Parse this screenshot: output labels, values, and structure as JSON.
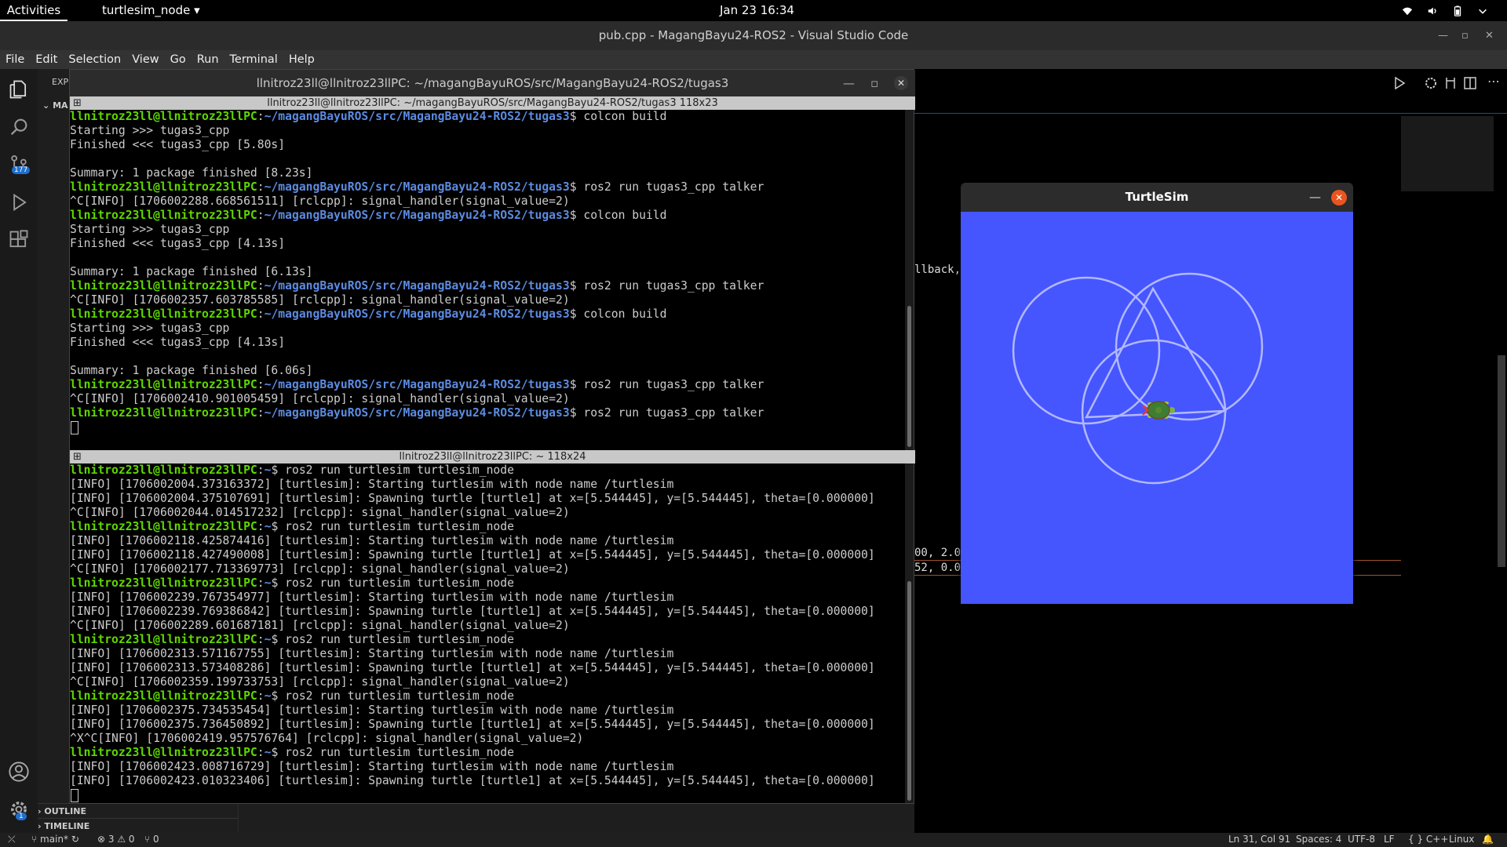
{
  "topbar": {
    "activities": "Activities",
    "app_menu": "turtlesim_node",
    "clock": "Jan 23  16:34"
  },
  "vscode": {
    "title": "pub.cpp - MagangBayu24-ROS2 - Visual Studio Code",
    "menu": [
      "File",
      "Edit",
      "Selection",
      "View",
      "Go",
      "Run",
      "Terminal",
      "Help"
    ],
    "explorer_label": "EXP",
    "explorer_root": "MA",
    "outline": "OUTLINE",
    "timeline": "TIMELINE",
    "scm_badge": "177",
    "settings_badge": "1",
    "code_fragments": [
      "llback,",
      "00, 2.0",
      "52, 0.0"
    ]
  },
  "statusbar": {
    "branch": "main*",
    "problems": "⊗ 3 ⚠ 0",
    "ports": "⑂ 0",
    "position": "Ln 31, Col 91",
    "spaces": "Spaces: 4",
    "encoding": "UTF-8",
    "eol": "LF",
    "language": "{ } C++",
    "platform": "Linux"
  },
  "terminal": {
    "window_title": "llnitroz23ll@llnitroz23llPC: ~/magangBayuROS/src/MagangBayu24-ROS2/tugas3",
    "top_pane_title": "llnitroz23ll@llnitroz23llPC: ~/magangBayuROS/src/MagangBayu24-ROS2/tugas3 118x23",
    "bottom_pane_title": "llnitroz23ll@llnitroz23llPC: ~ 118x24",
    "user": "llnitroz23ll@llnitroz23llPC",
    "top_path": "~/magangBayuROS/src/MagangBayu24-ROS2/tugas3",
    "home_path": "~",
    "top_lines": [
      {
        "p": true,
        "t": "colcon build"
      },
      {
        "p": false,
        "t": "Starting >>> tugas3_cpp"
      },
      {
        "p": false,
        "t": "Finished <<< tugas3_cpp [5.80s]"
      },
      {
        "p": false,
        "t": ""
      },
      {
        "p": false,
        "t": "Summary: 1 package finished [8.23s]"
      },
      {
        "p": true,
        "t": "ros2 run tugas3_cpp talker"
      },
      {
        "p": false,
        "t": "^C[INFO] [1706002288.668561511] [rclcpp]: signal_handler(signal_value=2)"
      },
      {
        "p": true,
        "t": "colcon build"
      },
      {
        "p": false,
        "t": "Starting >>> tugas3_cpp"
      },
      {
        "p": false,
        "t": "Finished <<< tugas3_cpp [4.13s]"
      },
      {
        "p": false,
        "t": ""
      },
      {
        "p": false,
        "t": "Summary: 1 package finished [6.13s]"
      },
      {
        "p": true,
        "t": "ros2 run tugas3_cpp talker"
      },
      {
        "p": false,
        "t": "^C[INFO] [1706002357.603785585] [rclcpp]: signal_handler(signal_value=2)"
      },
      {
        "p": true,
        "t": "colcon build"
      },
      {
        "p": false,
        "t": "Starting >>> tugas3_cpp"
      },
      {
        "p": false,
        "t": "Finished <<< tugas3_cpp [4.13s]"
      },
      {
        "p": false,
        "t": ""
      },
      {
        "p": false,
        "t": "Summary: 1 package finished [6.06s]"
      },
      {
        "p": true,
        "t": "ros2 run tugas3_cpp talker"
      },
      {
        "p": false,
        "t": "^C[INFO] [1706002410.901005459] [rclcpp]: signal_handler(signal_value=2)"
      },
      {
        "p": true,
        "t": "ros2 run tugas3_cpp talker"
      }
    ],
    "bottom_lines": [
      {
        "p": true,
        "t": "ros2 run turtlesim turtlesim_node"
      },
      {
        "p": false,
        "t": "[INFO] [1706002004.373163372] [turtlesim]: Starting turtlesim with node name /turtlesim"
      },
      {
        "p": false,
        "t": "[INFO] [1706002004.375107691] [turtlesim]: Spawning turtle [turtle1] at x=[5.544445], y=[5.544445], theta=[0.000000]"
      },
      {
        "p": false,
        "t": "^C[INFO] [1706002044.014517232] [rclcpp]: signal_handler(signal_value=2)"
      },
      {
        "p": true,
        "t": "ros2 run turtlesim turtlesim_node"
      },
      {
        "p": false,
        "t": "[INFO] [1706002118.425874416] [turtlesim]: Starting turtlesim with node name /turtlesim"
      },
      {
        "p": false,
        "t": "[INFO] [1706002118.427490008] [turtlesim]: Spawning turtle [turtle1] at x=[5.544445], y=[5.544445], theta=[0.000000]"
      },
      {
        "p": false,
        "t": "^C[INFO] [1706002177.713369773] [rclcpp]: signal_handler(signal_value=2)"
      },
      {
        "p": true,
        "t": "ros2 run turtlesim turtlesim_node"
      },
      {
        "p": false,
        "t": "[INFO] [1706002239.767354977] [turtlesim]: Starting turtlesim with node name /turtlesim"
      },
      {
        "p": false,
        "t": "[INFO] [1706002239.769386842] [turtlesim]: Spawning turtle [turtle1] at x=[5.544445], y=[5.544445], theta=[0.000000]"
      },
      {
        "p": false,
        "t": "^C[INFO] [1706002289.601687181] [rclcpp]: signal_handler(signal_value=2)"
      },
      {
        "p": true,
        "t": "ros2 run turtlesim turtlesim_node"
      },
      {
        "p": false,
        "t": "[INFO] [1706002313.571167755] [turtlesim]: Starting turtlesim with node name /turtlesim"
      },
      {
        "p": false,
        "t": "[INFO] [1706002313.573408286] [turtlesim]: Spawning turtle [turtle1] at x=[5.544445], y=[5.544445], theta=[0.000000]"
      },
      {
        "p": false,
        "t": "^C[INFO] [1706002359.199733753] [rclcpp]: signal_handler(signal_value=2)"
      },
      {
        "p": true,
        "t": "ros2 run turtlesim turtlesim_node"
      },
      {
        "p": false,
        "t": "[INFO] [1706002375.734535454] [turtlesim]: Starting turtlesim with node name /turtlesim"
      },
      {
        "p": false,
        "t": "[INFO] [1706002375.736450892] [turtlesim]: Spawning turtle [turtle1] at x=[5.544445], y=[5.544445], theta=[0.000000]"
      },
      {
        "p": false,
        "t": "^X^C[INFO] [1706002419.957576764] [rclcpp]: signal_handler(signal_value=2)"
      },
      {
        "p": true,
        "t": "ros2 run turtlesim turtlesim_node"
      },
      {
        "p": false,
        "t": "[INFO] [1706002423.008716729] [turtlesim]: Starting turtlesim with node name /turtlesim"
      },
      {
        "p": false,
        "t": "[INFO] [1706002423.010323406] [turtlesim]: Spawning turtle [turtle1] at x=[5.544445], y=[5.544445], theta=[0.000000]"
      }
    ]
  },
  "turtlesim": {
    "title": "TurtleSim",
    "background_color": "#4556ff",
    "pen_color": "#b3b8ff"
  }
}
